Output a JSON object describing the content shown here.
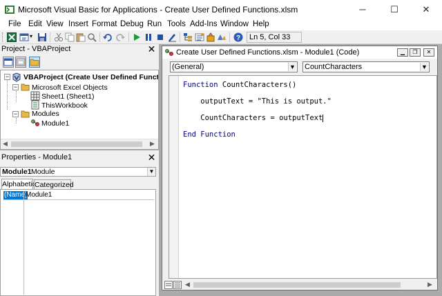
{
  "window": {
    "title": "Microsoft Visual Basic for Applications - Create User Defined Functions.xlsm",
    "minimize": "─",
    "maximize": "☐",
    "close": "✕"
  },
  "menu": [
    "File",
    "Edit",
    "View",
    "Insert",
    "Format",
    "Debug",
    "Run",
    "Tools",
    "Add-Ins",
    "Window",
    "Help"
  ],
  "toolbar": {
    "icons": [
      "view-excel-icon",
      "insert-module-icon",
      "save-icon",
      "cut-icon",
      "copy-icon",
      "paste-icon",
      "find-icon",
      "undo-icon",
      "redo-icon",
      "run-icon",
      "break-icon",
      "reset-icon",
      "design-mode-icon",
      "project-explorer-icon",
      "properties-icon",
      "object-browser-icon",
      "toolbox-icon",
      "help-icon"
    ],
    "position": "Ln 5, Col 33"
  },
  "project_pane": {
    "title": "Project - VBAProject",
    "close": "✕",
    "tree": [
      {
        "label": "VBAProject (Create User Defined Functions.xl",
        "level": 0,
        "bold": true
      },
      {
        "label": "Microsoft Excel Objects",
        "level": 1
      },
      {
        "label": "Sheet1 (Sheet1)",
        "level": 2
      },
      {
        "label": "ThisWorkbook",
        "level": 2
      },
      {
        "label": "Modules",
        "level": 1
      },
      {
        "label": "Module1",
        "level": 2
      }
    ]
  },
  "properties_pane": {
    "title": "Properties - Module1",
    "close": "✕",
    "object_name": "Module1",
    "object_type": "Module",
    "tabs": [
      "Alphabetic",
      "Categorized"
    ],
    "rows": [
      {
        "name": "(Name)",
        "value": "Module1"
      }
    ]
  },
  "code_window": {
    "title": "Create User Defined Functions.xlsm - Module1 (Code)",
    "object_combo": "(General)",
    "proc_combo": "CountCharacters",
    "lines": [
      {
        "kw": "Function",
        "rest": " CountCharacters()"
      },
      {
        "kw": "",
        "rest": "    outputText = \"This is output.\""
      },
      {
        "kw": "",
        "rest": "    CountCharacters = outputText"
      },
      {
        "kw": "End Function",
        "rest": ""
      }
    ]
  },
  "colors": {
    "title_bg": "#ffffff",
    "panel_bg": "#f0f0f0",
    "workspace_bg": "#ababab",
    "keyword": "#00007f",
    "selection": "#0078d7"
  }
}
